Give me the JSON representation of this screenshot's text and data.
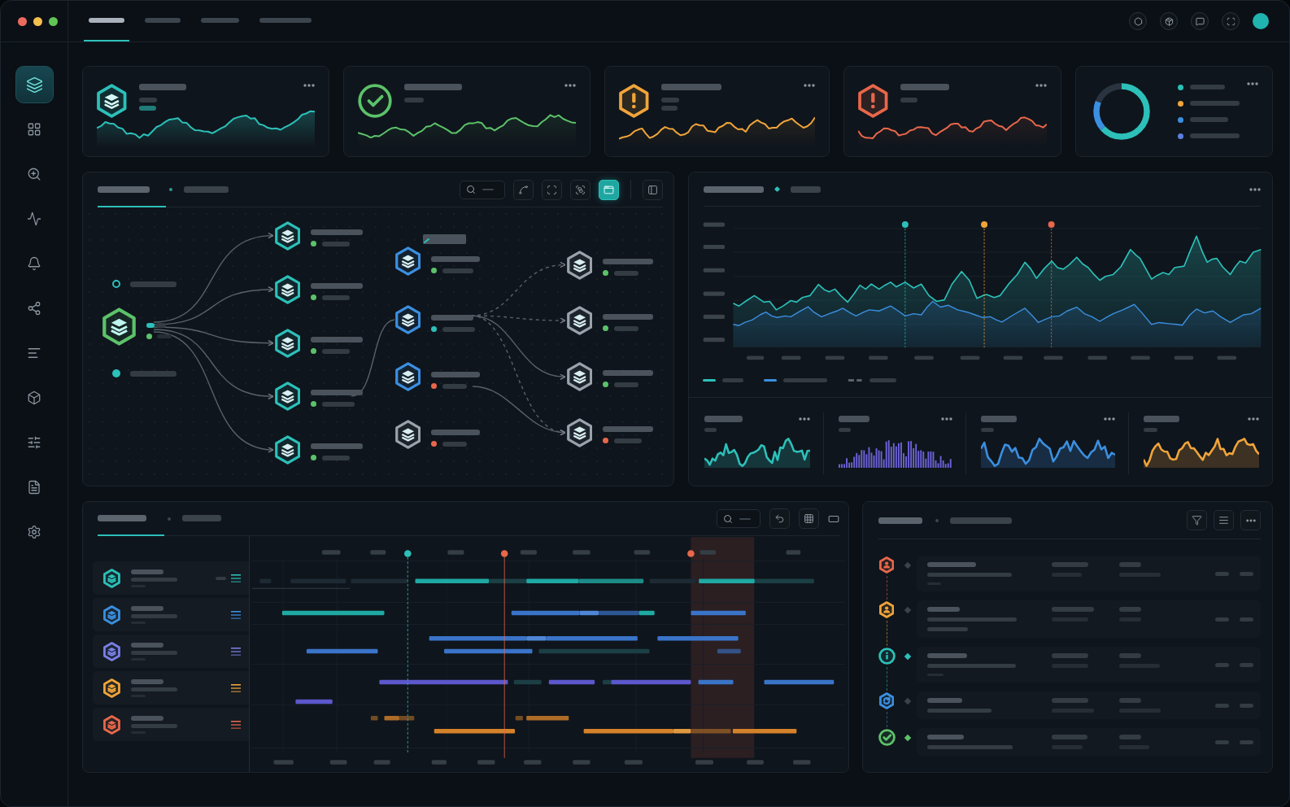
{
  "window": {
    "controls": [
      {
        "color": "#ec6a5e"
      },
      {
        "color": "#f4bf4f"
      },
      {
        "color": "#61c554"
      }
    ]
  },
  "top_tabs": [
    {
      "selected": true
    },
    {
      "selected": false
    },
    {
      "selected": false
    },
    {
      "selected": false
    }
  ],
  "sidebar": {
    "items": [
      {
        "selected": true
      },
      {
        "selected": false
      },
      {
        "selected": false
      },
      {
        "selected": false
      },
      {
        "selected": false
      },
      {
        "selected": false
      },
      {
        "selected": false
      },
      {
        "selected": false
      },
      {
        "selected": false
      },
      {
        "selected": false
      },
      {
        "selected": false
      }
    ]
  },
  "stat_cards": [
    {
      "kind": "service",
      "color": "#2cc0b9"
    },
    {
      "kind": "success",
      "color": "#5cc26a"
    },
    {
      "kind": "warning",
      "color": "#f0a43a"
    },
    {
      "kind": "error",
      "color": "#e8674a"
    }
  ],
  "distribution_card": {
    "legend": [
      {
        "color": "#2cc0b9"
      },
      {
        "color": "#f0a43a"
      },
      {
        "color": "#3b8fe0"
      },
      {
        "color": "#5b7fe0"
      }
    ]
  },
  "flow_panel": {
    "tabs": [
      {
        "selected": true
      },
      {
        "selected": false
      }
    ],
    "toolbar": [
      {
        "selected": false
      },
      {
        "selected": false
      },
      {
        "selected": false
      },
      {
        "selected": true
      },
      {
        "selected": false
      }
    ],
    "inputs": [
      {
        "kind": "ring",
        "color": "#2cc0b9"
      },
      {
        "kind": "dot",
        "color": "#2cc0b9"
      }
    ],
    "source": {
      "color": "#5cc26a",
      "status": {
        "color": "#5cc26a"
      }
    },
    "columns": [
      {
        "nodes": [
          {
            "color": "#2cc0b9",
            "status": {
              "color": "#5cc26a"
            }
          },
          {
            "color": "#2cc0b9",
            "status": {
              "color": "#5cc26a"
            }
          },
          {
            "color": "#2cc0b9",
            "status": {
              "color": "#5cc26a"
            }
          },
          {
            "color": "#2cc0b9",
            "status": {
              "color": "#5cc26a"
            }
          },
          {
            "color": "#2cc0b9",
            "status": {
              "color": "#5cc26a"
            }
          }
        ]
      },
      {
        "nodes": [
          {
            "color": "#3b8fe0",
            "status": {
              "color": "#5cc26a"
            }
          },
          {
            "color": "#3b8fe0",
            "status": {
              "color": "#2cc0b9"
            }
          },
          {
            "color": "#3b8fe0",
            "status": {
              "color": "#e8674a"
            }
          },
          {
            "color": "#9aa3ad",
            "status": {
              "color": "#e8674a"
            }
          }
        ]
      },
      {
        "nodes": [
          {
            "color": "#9aa3ad",
            "status": {
              "color": "#5cc26a"
            }
          },
          {
            "color": "#9aa3ad",
            "status": {
              "color": "#5cc26a"
            }
          },
          {
            "color": "#9aa3ad",
            "status": {
              "color": "#5cc26a"
            }
          },
          {
            "color": "#9aa3ad",
            "status": {
              "color": "#e8674a"
            }
          }
        ]
      }
    ]
  },
  "trend_panel": {
    "markers": [
      {
        "color": "#2cc0b9"
      },
      {
        "color": "#f0a43a"
      },
      {
        "color": "#e8674a"
      }
    ],
    "legend": [
      {
        "kind": "solid",
        "color": "#2cc0b9"
      },
      {
        "kind": "solid",
        "color": "#3b8fe0"
      },
      {
        "kind": "dashed",
        "color": "#5a636c"
      }
    ],
    "mini_charts": [
      {
        "kind": "area",
        "color": "#2cc0b9"
      },
      {
        "kind": "bars",
        "color": "#6c63d8"
      },
      {
        "kind": "area",
        "color": "#3b8fe0"
      },
      {
        "kind": "area",
        "color": "#f0a43a"
      }
    ]
  },
  "schedule_panel": {
    "tabs": [
      {
        "selected": true
      },
      {
        "selected": false
      }
    ],
    "rows": [
      {
        "color": "#2cc0b9"
      },
      {
        "color": "#3b8fe0"
      },
      {
        "color": "#7a7fe6"
      },
      {
        "color": "#f0a43a"
      },
      {
        "color": "#e8674a"
      }
    ]
  },
  "activity_panel": {
    "items": [
      {
        "kind": "user",
        "color": "#e8674a",
        "active": false
      },
      {
        "kind": "user",
        "color": "#f0a43a",
        "active": false
      },
      {
        "kind": "info",
        "color": "#2cc0b9",
        "active": true
      },
      {
        "kind": "sync",
        "color": "#3b8fe0",
        "active": false
      },
      {
        "kind": "check",
        "color": "#5cc26a",
        "active": true
      }
    ]
  }
}
